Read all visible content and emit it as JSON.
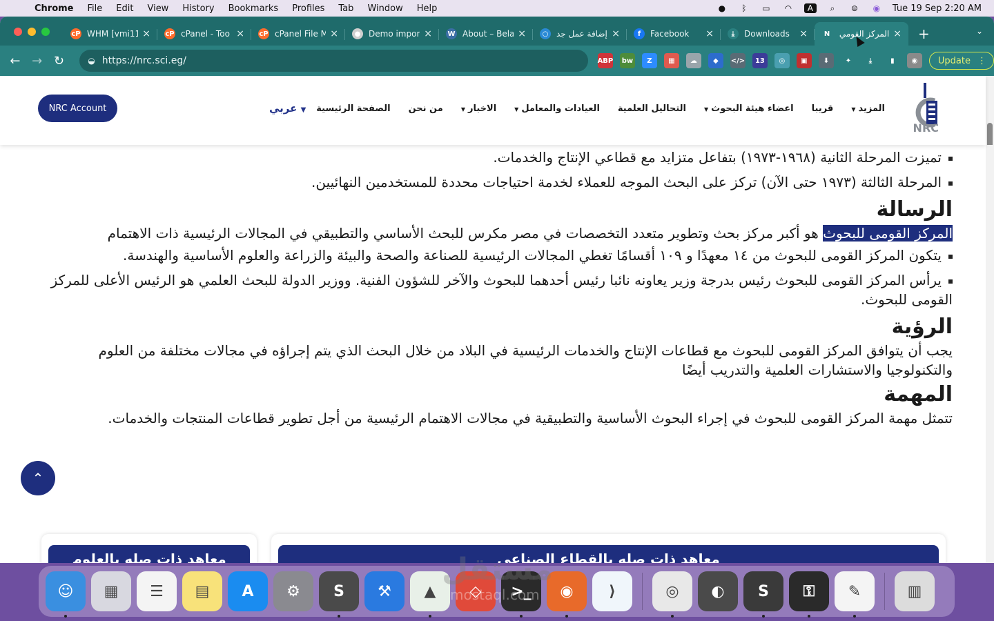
{
  "menubar": {
    "app": "Chrome",
    "items": [
      "File",
      "Edit",
      "View",
      "History",
      "Bookmarks",
      "Profiles",
      "Tab",
      "Window",
      "Help"
    ],
    "clock": "Tue 19 Sep  2:20 AM",
    "status_icons": [
      "camera-icon",
      "bluetooth-icon",
      "battery-icon",
      "wifi-icon",
      "keyboard-input-icon",
      "spotlight-icon",
      "control-center-icon",
      "siri-icon"
    ],
    "input_letter": "A"
  },
  "browser": {
    "tabs": [
      {
        "title": "WHM [vmi11",
        "icon": "cpanel-icon",
        "color": "#ff6c2c",
        "glyph": "cP"
      },
      {
        "title": "cPanel - Too",
        "icon": "cpanel-icon",
        "color": "#ff6c2c",
        "glyph": "cP"
      },
      {
        "title": "cPanel File M",
        "icon": "cpanel-icon",
        "color": "#ff6c2c",
        "glyph": "cP"
      },
      {
        "title": "Demo import",
        "icon": "demo-icon",
        "color": "#cfcfcf",
        "glyph": "●"
      },
      {
        "title": "About – Bela",
        "icon": "wordpress-icon",
        "color": "#3b6ea5",
        "glyph": "W"
      },
      {
        "title": "إضافة عمل جد",
        "icon": "mostaql-icon",
        "color": "#2a8ad6",
        "glyph": "○"
      },
      {
        "title": "Facebook",
        "icon": "facebook-icon",
        "color": "#1877f2",
        "glyph": "f"
      },
      {
        "title": "Downloads",
        "icon": "download-icon",
        "color": "#2a8080",
        "glyph": "⤓"
      },
      {
        "title": "المركز القومي ل",
        "icon": "nrc-icon",
        "color": "#2a8080",
        "glyph": "N",
        "active": true
      }
    ],
    "new_tab": "+",
    "tab_menu": "⌄",
    "url": "https://nrc.sci.eg/",
    "update_label": "Update",
    "extensions": [
      {
        "name": "adblock-icon",
        "color": "#d0343a",
        "label": "ABP"
      },
      {
        "name": "bw-icon",
        "color": "#4d8c3a",
        "label": "bw"
      },
      {
        "name": "zoom-icon",
        "color": "#2d8cff",
        "label": "Z"
      },
      {
        "name": "calendar-icon",
        "color": "#e05a4f",
        "label": "▦"
      },
      {
        "name": "cloud-icon",
        "color": "#9aa5ab",
        "label": "☁"
      },
      {
        "name": "tag-icon",
        "color": "#2d6ccc",
        "label": "◆"
      },
      {
        "name": "code-icon",
        "color": "#5a6b75",
        "label": "</>"
      },
      {
        "name": "puzzle-badge-icon",
        "color": "#3c3c99",
        "label": "13"
      },
      {
        "name": "globe-icon",
        "color": "#4a9fb0",
        "label": "◎"
      },
      {
        "name": "flag-icon",
        "color": "#c03030",
        "label": "▣"
      },
      {
        "name": "shield-icon",
        "color": "#5a6b75",
        "label": "⬇"
      },
      {
        "name": "extensions-icon",
        "color": "#2a8080",
        "label": "✦"
      },
      {
        "name": "downloads-icon",
        "color": "#2a8080",
        "label": "⤓"
      },
      {
        "name": "sidepanel-icon",
        "color": "#2a8080",
        "label": "▮"
      },
      {
        "name": "profile-avatar-icon",
        "color": "#8a8a8a",
        "label": "◉"
      }
    ]
  },
  "site": {
    "nav": [
      {
        "label": "الصفحة الرئيسية",
        "caret": false
      },
      {
        "label": "من نحن",
        "caret": false
      },
      {
        "label": "الاخبار",
        "caret": true
      },
      {
        "label": "العيادات والمعامل",
        "caret": true
      },
      {
        "label": "التحاليل العلمية",
        "caret": false
      },
      {
        "label": "اعضاء هيئة البحوث",
        "caret": true
      },
      {
        "label": "قريبا",
        "caret": false
      },
      {
        "label": "المزيد",
        "caret": true
      }
    ],
    "language": "عربي",
    "account_button": "NRC Account",
    "logo_text": "NRC"
  },
  "content": {
    "bullets_top": [
      "تميزت المرحلة الثانية (١٩٦٨-١٩٧٣) بتفاعل متزايد مع قطاعي الإنتاج والخدمات.",
      "المرحلة الثالثة (١٩٧٣ حتى الآن) تركز على البحث الموجه للعملاء لخدمة احتياجات محددة للمستخدمين النهائيين."
    ],
    "mission": {
      "heading": "الرسالة",
      "highlight": "المركز القومى للبحوث",
      "text": " هو أكبر مركز بحث وتطوير متعدد التخصصات في مصر مكرس للبحث الأساسي والتطبيقي في المجالات الرئيسية ذات الاهتمام",
      "bullets": [
        "يتكون المركز القومى للبحوث من ١٤ معهدًا و ١٠٩ أقسامًا تغطي المجالات الرئيسية للصناعة والصحة والبيئة والزراعة والعلوم الأساسية والهندسة.",
        "يرأس المركز القومى للبحوث رئيس بدرجة وزير يعاونه نائبا رئيس أحدهما للبحوث والآخر للشؤون الفنية. ووزير الدولة للبحث العلمي هو الرئيس الأعلى للمركز القومى للبحوث."
      ]
    },
    "vision": {
      "heading": "الرؤية",
      "text": "يجب أن يتوافق المركز القومى للبحوث مع قطاعات الإنتاج والخدمات الرئيسية في البلاد من خلال البحث الذي يتم إجراؤه في مجالات مختلفة من العلوم والتكنولوجيا والاستشارات العلمية والتدريب أيضًا"
    },
    "task": {
      "heading": "المهمة",
      "text": "تتمثل مهمة المركز القومى للبحوث في إجراء البحوث الأساسية والتطبيقية في مجالات الاهتمام الرئيسية من أجل تطوير قطاعات المنتجات والخدمات."
    },
    "cards": [
      "معاهد ذات صله بالقطاع الصناعي",
      "معاهد ذات صله بالعلوم"
    ],
    "back_to_top": "⌃"
  },
  "dock": {
    "apps": [
      {
        "name": "finder-icon",
        "color": "#3a8fe0",
        "glyph": "☺",
        "run": true
      },
      {
        "name": "launchpad-icon",
        "color": "#d8d8e0",
        "glyph": "▦",
        "run": false
      },
      {
        "name": "reminders-icon",
        "color": "#f4f4f4",
        "glyph": "☰",
        "run": false
      },
      {
        "name": "notes-icon",
        "color": "#f8e27a",
        "glyph": "▤",
        "run": false
      },
      {
        "name": "app-store-icon",
        "color": "#1a8cf0",
        "glyph": "A",
        "run": false
      },
      {
        "name": "system-preferences-icon",
        "color": "#8a8a90",
        "glyph": "⚙",
        "run": false
      },
      {
        "name": "sublime-text-icon",
        "color": "#4a4a4a",
        "glyph": "S",
        "run": true
      },
      {
        "name": "xcode-icon",
        "color": "#2a7ae0",
        "glyph": "⚒",
        "run": false
      },
      {
        "name": "android-studio-icon",
        "color": "#e8f0e8",
        "glyph": "▲",
        "run": true
      },
      {
        "name": "anydesk-icon",
        "color": "#e04a3a",
        "glyph": "◇",
        "run": false
      },
      {
        "name": "terminal-icon",
        "color": "#2a2a2a",
        "glyph": ">_",
        "run": true
      },
      {
        "name": "firefox-icon",
        "color": "#e86a2a",
        "glyph": "◉",
        "run": true
      },
      {
        "name": "vscode-icon",
        "color": "#f0f6fb",
        "glyph": "⟩",
        "run": false
      },
      {
        "name": "chrome-icon",
        "color": "#e8e8e8",
        "glyph": "◎",
        "run": true
      },
      {
        "name": "sequel-pro-icon",
        "color": "#4a4a4a",
        "glyph": "◐",
        "run": false
      },
      {
        "name": "sublime-merge-icon",
        "color": "#3a3a3a",
        "glyph": "S",
        "run": true
      },
      {
        "name": "keychain-icon",
        "color": "#2a2a2a",
        "glyph": "⚿",
        "run": true
      },
      {
        "name": "textedit-icon",
        "color": "#f4f4f4",
        "glyph": "✎",
        "run": true
      },
      {
        "name": "trash-icon",
        "color": "#dcdcdc",
        "glyph": "▥",
        "run": false
      }
    ],
    "watermark": "مستقل",
    "watermark_sub": "mostaql.com"
  }
}
